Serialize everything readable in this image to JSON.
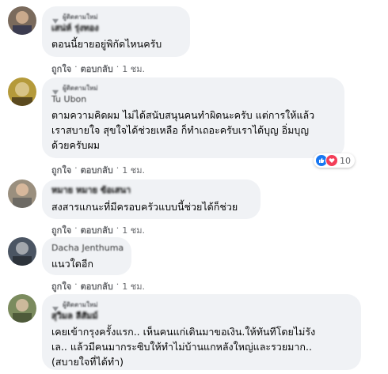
{
  "comments": [
    {
      "badge": "ผู้ติดตามใหม่",
      "author": "เสน่ห์ รุ่งทอง",
      "text": "ตอนนี้ยายอยู่พิกัดไหนครับ",
      "actions": {
        "like": "ถูกใจ",
        "reply": "ตอบกลับ",
        "time": "1 ชม."
      }
    },
    {
      "badge": "ผู้ติดตามใหม่",
      "author": "Tu Ubon",
      "text": "ตามความคิดผม ไม่ได้สนับสนุนคนทำผิดนะครับ แต่การให้แล้ว\nเราสบายใจ สุขใจได้ช่วยเหลือ ก็ทำเถอะครับเราได้บุญ อิ่มบุญ\nด้วยครับผม",
      "actions": {
        "like": "ถูกใจ",
        "reply": "ตอบกลับ",
        "time": "1 ชม."
      },
      "reactions": {
        "icons": [
          "like-icon",
          "love-icon"
        ],
        "count": "10",
        "like_color": "#1877f2",
        "love_color": "#f33e58"
      }
    },
    {
      "badge": "",
      "author": "หมาย หมาย ข้อเสนา",
      "text": "สงสารแกนะที่มีครอบครัวแบบนี้ช่วยได้ก็ช่วย",
      "actions": {
        "like": "ถูกใจ",
        "reply": "ตอบกลับ",
        "time": "1 ชม."
      }
    },
    {
      "badge": "",
      "author": "Dacha Jenthuma",
      "text": "แนวใดอีก",
      "actions": {
        "like": "ถูกใจ",
        "reply": "ตอบกลับ",
        "time": "1 ชม."
      }
    },
    {
      "badge": "ผู้ติดตามใหม่",
      "author": "สุวิมล ลีสัมม์",
      "text": "เคยเข้ากรุงครั้งแรก.. เห็นคนแก่เดินมาขอเงิน.ให้ทันทีโดยไม่รัง\nเล.. แล้วมีคนมากระซิบให้ทำไม่บ้านแกหลังใหญ่และรวยมาก..\n(สบายใจที่ได้ทำ)",
      "actions": {
        "like": "ถูกใจ",
        "reply": "ตอบกลับ",
        "time": "1 ชม."
      }
    }
  ],
  "separator": "·",
  "colors": {
    "bubble": "#f0f2f5",
    "meta": "#65676b",
    "text": "#050505"
  }
}
